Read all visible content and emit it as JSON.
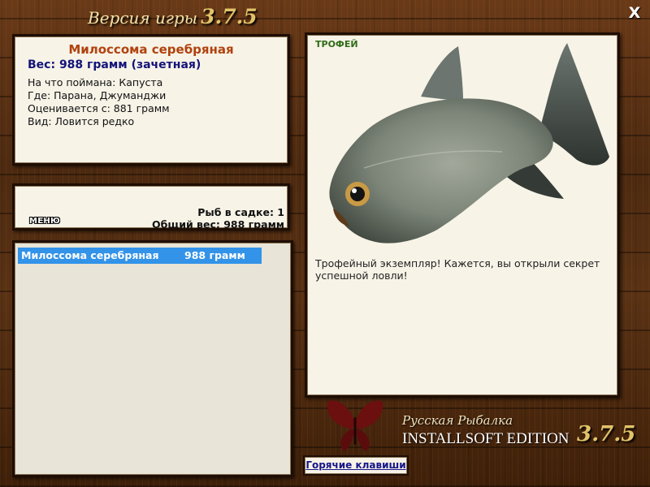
{
  "header": {
    "version_label": "Версия игры",
    "version_number": "3.7.5",
    "close_glyph": "X"
  },
  "fish_info": {
    "name": "Милоссома серебряная",
    "weight_line": "Вес: 988 грамм (зачетная)",
    "rows": [
      "На что поймана: Капуста",
      "Где: Парана, Джуманджи",
      "Оценивается с: 881 грамм",
      "Вид: Ловится редко"
    ]
  },
  "stats": {
    "menu_label": "МЕНЮ",
    "fish_count": "Рыб в садке: 1",
    "total_weight": "Общий вес: 988 грамм"
  },
  "catch_list": [
    {
      "name": "Милоссома серебряная",
      "weight": "988 грамм"
    }
  ],
  "trophy": {
    "label": "ТРОФЕЙ",
    "description": "Трофейный экземпляр! Кажется, вы открыли секрет успешной ловли!",
    "image_icon": "silver-dollar-fish-image"
  },
  "logo": {
    "line1": "Русская Рыбалка",
    "line2": "INSTALLSOFT EDITION",
    "version": "3.7.5",
    "icon": "butterfly-logo-icon"
  },
  "footer": {
    "hotkeys_label": "Горячие клавиши"
  },
  "colors": {
    "fish_name": "#b1420e",
    "weight_text": "#14147a",
    "list_highlight": "#3393e8",
    "trophy_label": "#2f6b17",
    "version_gold": "#e2c36a",
    "butterfly": "#6b0f0f"
  }
}
